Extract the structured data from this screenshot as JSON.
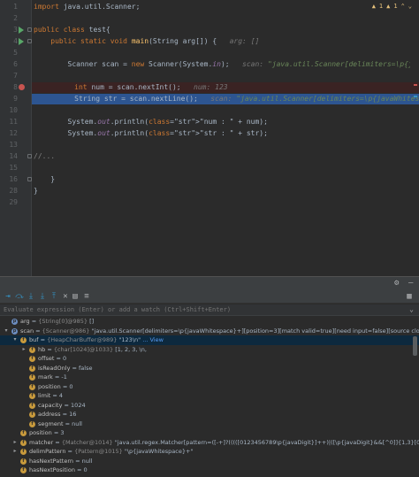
{
  "editor": {
    "warnings": {
      "warn_count": "1",
      "info_count": "1"
    },
    "lines": [
      {
        "num": "1",
        "text": "import java.util.Scanner;"
      },
      {
        "num": "2",
        "text": ""
      },
      {
        "num": "3",
        "text": "public class test{"
      },
      {
        "num": "4",
        "text": "    public static void main(String arg[]) {",
        "hint": "arg: []"
      },
      {
        "num": "5",
        "text": ""
      },
      {
        "num": "6",
        "text": "        Scanner scan = new Scanner(System.in);",
        "hint": "scan: \"java.util.Scanner[delimiters=\\p{javaWhitespace}+][position=3]"
      },
      {
        "num": "7",
        "text": ""
      },
      {
        "num": "8",
        "text": "        int num = scan.nextInt();",
        "hint": "num: 123"
      },
      {
        "num": "9",
        "text": "        String str = scan.nextLine();",
        "hint": "scan: \"java.util.Scanner[delimiters=\\p{javaWhitespace}+][position=3]"
      },
      {
        "num": "10",
        "text": ""
      },
      {
        "num": "11",
        "text": "        System.out.println(\"num : \" + num);"
      },
      {
        "num": "12",
        "text": "        System.out.println(\"str : \" + str);"
      },
      {
        "num": "13",
        "text": ""
      },
      {
        "num": "14",
        "text": "//..."
      },
      {
        "num": "15",
        "text": ""
      },
      {
        "num": "16",
        "text": "    }"
      },
      {
        "num": "28",
        "text": ""
      },
      {
        "num": "29",
        "text": "}"
      }
    ]
  },
  "debug": {
    "eval_placeholder": "Evaluate expression (Enter) or add a watch (Ctrl+Shift+Enter)",
    "variables": [
      {
        "name": "arg",
        "eq": " = ",
        "type": "{String[0]@985}",
        "value": " []",
        "link": "",
        "indent": 0,
        "twisty": "",
        "icon": "p"
      },
      {
        "name": "scan",
        "eq": " = ",
        "type": "{Scanner@986}",
        "value": " \"java.util.Scanner[delimiters=\\p{javaWhitespace}+][position=3][match valid=true][need input=false][source closed=false][skip",
        "link": "",
        "indent": 0,
        "twisty": "v",
        "icon": "p"
      },
      {
        "name": "buf",
        "eq": " = ",
        "type": "{HeapCharBuffer@989}",
        "value": " \"123\\n\"",
        "link": "... View",
        "indent": 1,
        "twisty": "v",
        "icon": "f",
        "selected": true
      },
      {
        "name": "hb",
        "eq": " = ",
        "type": "{char[1024]@1033}",
        "value": " [1, 2, 3, \\n, ",
        "link": "",
        "indent": 2,
        "twisty": ">",
        "icon": "f"
      },
      {
        "name": "offset",
        "eq": " = ",
        "type": "",
        "value": "0",
        "link": "",
        "indent": 2,
        "twisty": "",
        "icon": "f"
      },
      {
        "name": "isReadOnly",
        "eq": " = ",
        "type": "",
        "value": "false",
        "link": "",
        "indent": 2,
        "twisty": "",
        "icon": "f"
      },
      {
        "name": "mark",
        "eq": " = ",
        "type": "",
        "value": "-1",
        "link": "",
        "indent": 2,
        "twisty": "",
        "icon": "f"
      },
      {
        "name": "position",
        "eq": " = ",
        "type": "",
        "value": "0",
        "link": "",
        "indent": 2,
        "twisty": "",
        "icon": "f"
      },
      {
        "name": "limit",
        "eq": " = ",
        "type": "",
        "value": "4",
        "link": "",
        "indent": 2,
        "twisty": "",
        "icon": "f"
      },
      {
        "name": "capacity",
        "eq": " = ",
        "type": "",
        "value": "1024",
        "link": "",
        "indent": 2,
        "twisty": "",
        "icon": "f"
      },
      {
        "name": "address",
        "eq": " = ",
        "type": "",
        "value": "16",
        "link": "",
        "indent": 2,
        "twisty": "",
        "icon": "f"
      },
      {
        "name": "segment",
        "eq": " = ",
        "type": "",
        "value": "null",
        "link": "",
        "indent": 2,
        "twisty": "",
        "icon": "f"
      },
      {
        "name": "position",
        "eq": " = ",
        "type": "",
        "value": "3",
        "link": "",
        "indent": 1,
        "twisty": "",
        "icon": "f"
      },
      {
        "name": "matcher",
        "eq": " = ",
        "type": "{Matcher@1014}",
        "value": " \"java.util.regex.Matcher[pattern=([-+]?(((([0123456789\\p{javaDigit}]++)|([\\p{javaDigit}&&[^0]]{1,3}[0123456E",
        "link": "",
        "indent": 1,
        "twisty": ">",
        "icon": "f"
      },
      {
        "name": "delimPattern",
        "eq": " = ",
        "type": "{Pattern@1015}",
        "value": " \"\\p{javaWhitespace}+\"",
        "link": "",
        "indent": 1,
        "twisty": ">",
        "icon": "f"
      },
      {
        "name": "hasNextPattern",
        "eq": " = ",
        "type": "",
        "value": "null",
        "link": "",
        "indent": 1,
        "twisty": "",
        "icon": "f"
      },
      {
        "name": "hasNextPosition",
        "eq": " = ",
        "type": "",
        "value": "0",
        "link": "",
        "indent": 1,
        "twisty": "",
        "icon": "f"
      }
    ]
  },
  "colors": {
    "accent": "#3592c4",
    "breakpoint": "#c75450",
    "selection": "#2d5591",
    "run": "#59a869"
  }
}
